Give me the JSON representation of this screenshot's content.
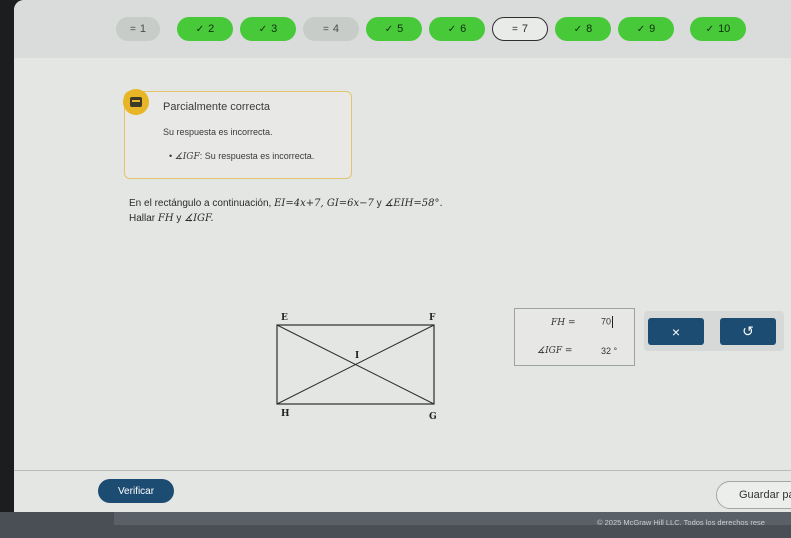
{
  "nav": {
    "items": [
      {
        "label": "1",
        "status": "partial"
      },
      {
        "label": "2",
        "status": "correct"
      },
      {
        "label": "3",
        "status": "correct"
      },
      {
        "label": "4",
        "status": "partial"
      },
      {
        "label": "5",
        "status": "correct"
      },
      {
        "label": "6",
        "status": "correct"
      },
      {
        "label": "7",
        "status": "current"
      },
      {
        "label": "8",
        "status": "correct"
      },
      {
        "label": "9",
        "status": "correct"
      },
      {
        "label": "10",
        "status": "correct"
      }
    ]
  },
  "feedback": {
    "title": "Parcialmente correcta",
    "subtitle": "Su respuesta es incorrecta.",
    "bullet_math": "∡IGF",
    "bullet_text": ": Su respuesta es incorrecta.",
    "icon": "partial-feedback-icon"
  },
  "problem": {
    "line1_prefix": "En el rectángulo a continuación, ",
    "line1_math1": "EI=4x+7, GI=6x−7",
    "line1_mid": " y ",
    "line1_math2": "∡EIH=58°.",
    "line2_prefix": "Hallar ",
    "line2_math1": "FH",
    "line2_mid": " y ",
    "line2_math2": "∡IGF."
  },
  "diagram": {
    "labels": {
      "E": "E",
      "F": "F",
      "I": "I",
      "H": "H",
      "G": "G"
    }
  },
  "answers": {
    "fh_label": "FH =",
    "fh_value": "70",
    "igf_label": "∡IGF =",
    "igf_value": "32",
    "igf_unit": "°"
  },
  "tools": {
    "clear_symbol": "×",
    "undo_symbol": "↺"
  },
  "actions": {
    "verify_label": "Verificar",
    "save_label": "Guardar para"
  },
  "footer": {
    "copyright": "© 2025 McGraw Hill LLC. Todos los derechos rese"
  },
  "colors": {
    "correct": "#47c93a",
    "primary": "#1d4c72",
    "partial_icon": "#e7b526"
  }
}
